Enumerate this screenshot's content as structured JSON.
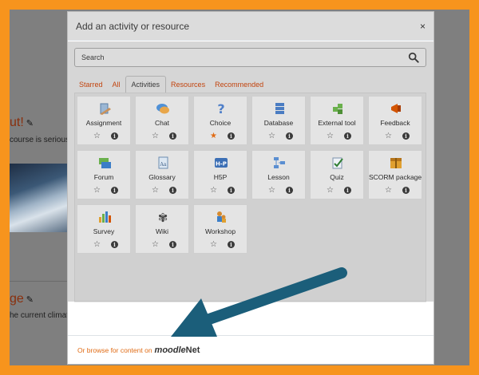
{
  "background": {
    "heading_1": "ut!",
    "snippet_1": "course is serious!",
    "heading_2": "ge",
    "snippet_2": "he current climate"
  },
  "modal": {
    "title": "Add an activity or resource",
    "close_glyph": "×",
    "search": {
      "placeholder": "Search"
    },
    "tabs": [
      {
        "label": "Starred"
      },
      {
        "label": "All"
      },
      {
        "label": "Activities"
      },
      {
        "label": "Resources"
      },
      {
        "label": "Recommended"
      }
    ],
    "active_tab": "Activities",
    "items": [
      {
        "label": "Assignment",
        "icon": "assignment-icon",
        "starred": false
      },
      {
        "label": "Chat",
        "icon": "chat-icon",
        "starred": false
      },
      {
        "label": "Choice",
        "icon": "choice-icon",
        "starred": true
      },
      {
        "label": "Database",
        "icon": "database-icon",
        "starred": false
      },
      {
        "label": "External tool",
        "icon": "external-tool-icon",
        "starred": false
      },
      {
        "label": "Feedback",
        "icon": "feedback-icon",
        "starred": false
      },
      {
        "label": "Forum",
        "icon": "forum-icon",
        "starred": false
      },
      {
        "label": "Glossary",
        "icon": "glossary-icon",
        "starred": false
      },
      {
        "label": "H5P",
        "icon": "h5p-icon",
        "starred": false
      },
      {
        "label": "Lesson",
        "icon": "lesson-icon",
        "starred": false
      },
      {
        "label": "Quiz",
        "icon": "quiz-icon",
        "starred": false
      },
      {
        "label": "SCORM package",
        "icon": "scorm-icon",
        "starred": false
      },
      {
        "label": "Survey",
        "icon": "survey-icon",
        "starred": false
      },
      {
        "label": "Wiki",
        "icon": "wiki-icon",
        "starred": false
      },
      {
        "label": "Workshop",
        "icon": "workshop-icon",
        "starred": false
      }
    ],
    "info_glyph": "i",
    "star_glyph": "☆",
    "star_filled_glyph": "★",
    "footer": {
      "browse_text": "Or browse for content on",
      "logo_m": "moodle",
      "logo_net": "Net"
    }
  },
  "colors": {
    "frame": "#f7941d",
    "accent": "#e06b14",
    "arrow": "#1b5e7a"
  }
}
